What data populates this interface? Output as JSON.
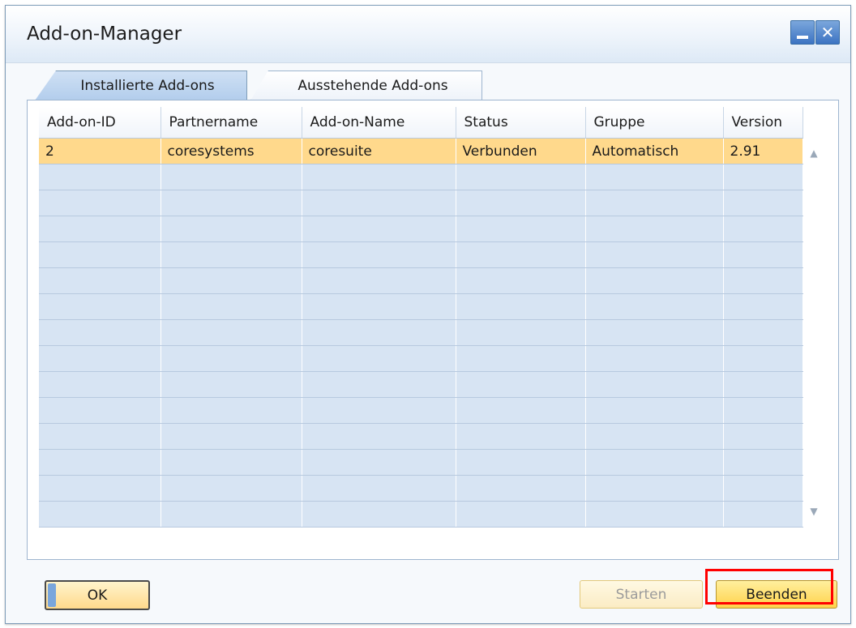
{
  "window": {
    "title": "Add-on-Manager"
  },
  "tabs": [
    {
      "label": "Installierte Add-ons",
      "active": true
    },
    {
      "label": "Ausstehende Add-ons",
      "active": false
    }
  ],
  "table": {
    "columns": [
      "Add-on-ID",
      "Partnername",
      "Add-on-Name",
      "Status",
      "Gruppe",
      "Version"
    ],
    "rows": [
      [
        "2",
        "coresystems",
        "coresuite",
        "Verbunden",
        "Automatisch",
        "2.91"
      ]
    ]
  },
  "buttons": {
    "ok": "OK",
    "start": "Starten",
    "stop": "Beenden"
  }
}
